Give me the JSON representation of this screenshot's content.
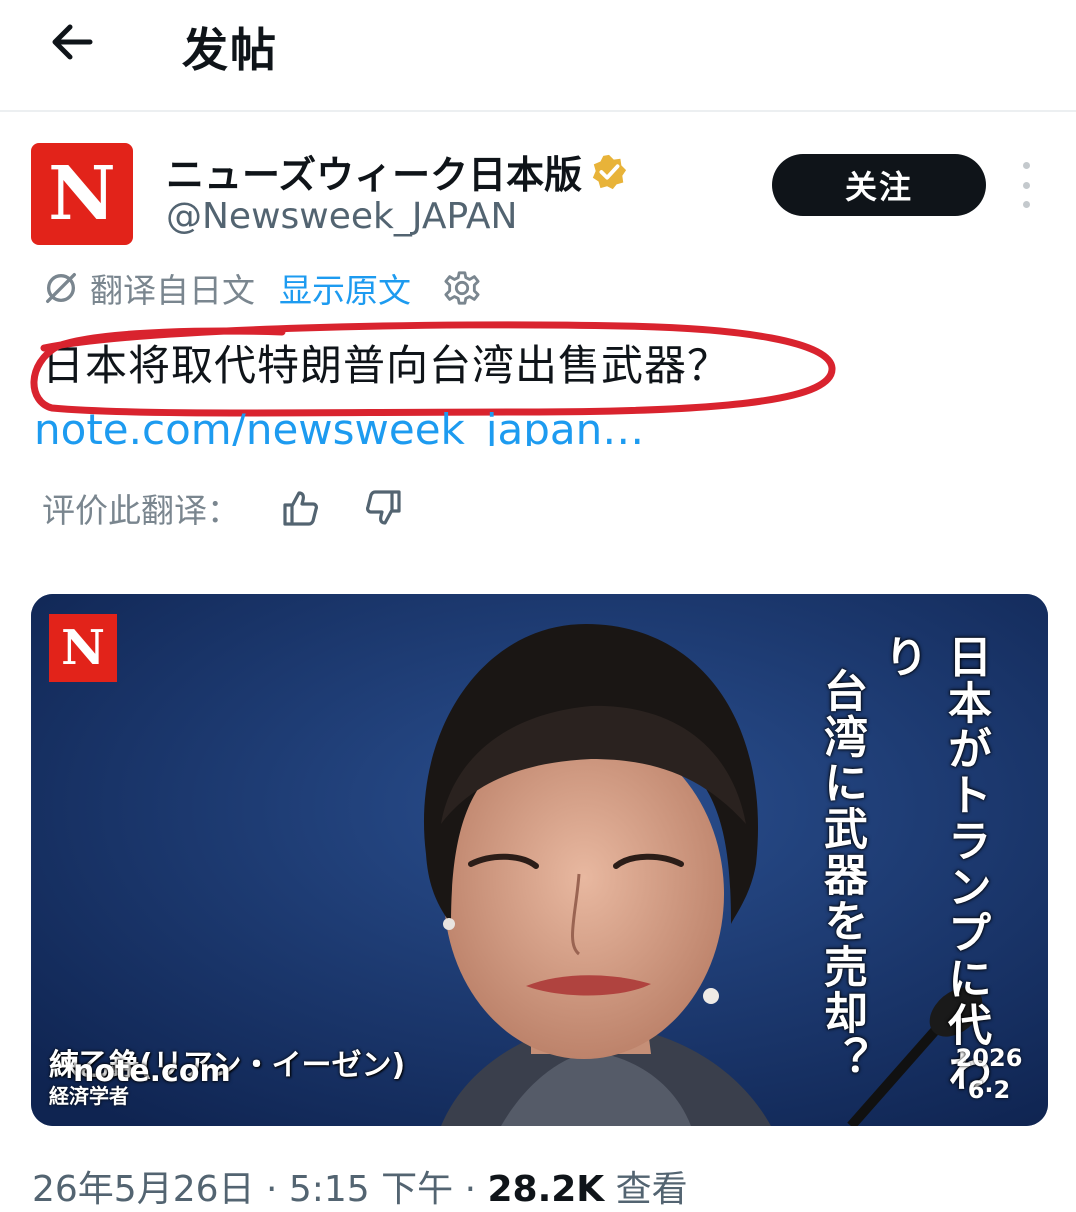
{
  "header": {
    "title": "发帖"
  },
  "author": {
    "avatar_letter": "N",
    "display_name": "ニューズウィーク日本版",
    "handle": "@Newsweek_JAPAN",
    "verified_badge": "gold-verified-icon"
  },
  "follow_label": "关注",
  "translation": {
    "label": "翻译自日文",
    "show_original": "显示原文"
  },
  "post": {
    "text": "日本将取代特朗普向台湾出售武器？",
    "link": "note.com/newsweek_japan…"
  },
  "rating": {
    "label": "评价此翻译："
  },
  "media": {
    "logo_letter": "N",
    "headline_line1": "日本がトランプに代わり",
    "headline_line2": "台湾に武器を売却？",
    "author_name": "練乙錚(リアン・イーゼン)",
    "author_role": "経済学者",
    "watermark": "note.com",
    "date_year": "2026",
    "date_day": "6·2"
  },
  "meta": {
    "timestamp": "26年5月26日 · 5:15 下午 · ",
    "views_count": "28.2K",
    "views_label": " 查看"
  },
  "colors": {
    "accent_blue": "#1d9bf0",
    "newsweek_red": "#e2231a",
    "verified_gold": "#e8b339",
    "annotation_red": "#d9232e"
  }
}
